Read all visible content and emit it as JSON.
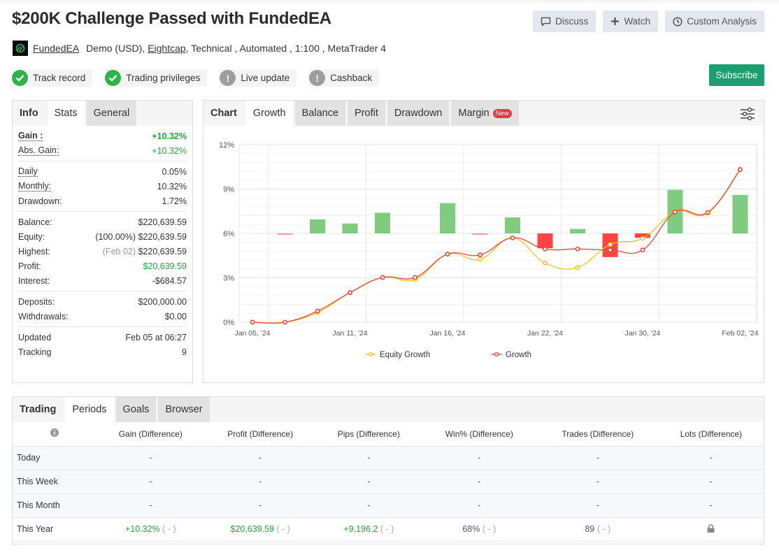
{
  "header": {
    "title": "$200K Challenge Passed with FundedEA",
    "buttons": [
      {
        "label": "Discuss",
        "icon": "comment-icon"
      },
      {
        "label": "Watch",
        "icon": "plus-icon"
      },
      {
        "label": "Custom Analysis",
        "icon": "clock-icon"
      }
    ],
    "author": "FundedEA",
    "meta_prefix": "Demo (USD),",
    "broker": "Eightcap",
    "meta_suffix": ", Technical , Automated , 1:100 , MetaTrader 4",
    "subscribe_label": "Subscribe"
  },
  "badges": [
    {
      "label": "Track record",
      "status": "ok"
    },
    {
      "label": "Trading privileges",
      "status": "ok"
    },
    {
      "label": "Live update",
      "status": "warn"
    },
    {
      "label": "Cashback",
      "status": "warn"
    }
  ],
  "stats_panel": {
    "tabs": [
      {
        "label": "Info"
      },
      {
        "label": "Stats"
      },
      {
        "label": "General"
      }
    ],
    "groups": [
      [
        {
          "label": "Gain :",
          "value": "+10.32%",
          "green": true,
          "bold": true,
          "dotted": true
        },
        {
          "label": "Abs. Gain:",
          "value": "+10.32%",
          "green": true,
          "dotted": true
        }
      ],
      [
        {
          "label": "Daily",
          "value": "0.05%",
          "dotted": true
        },
        {
          "label": "Monthly:",
          "value": "10.32%",
          "dotted": true
        },
        {
          "label": "Drawdown:",
          "value": "1.72%"
        }
      ],
      [
        {
          "label": "Balance:",
          "value": "$220,639.59"
        },
        {
          "label": "Equity:",
          "prefix": "(100.00%)",
          "value": "$220,639.59"
        },
        {
          "label": "Highest:",
          "prefix": "(Feb 02)",
          "prefix_muted": true,
          "value": "$220,639.59"
        },
        {
          "label": "Profit:",
          "value": "$20,639.59",
          "green": true
        },
        {
          "label": "Interest:",
          "value": "-$684.57"
        }
      ],
      [
        {
          "label": "Deposits:",
          "value": "$200,000.00"
        },
        {
          "label": "Withdrawals:",
          "value": "$0.00"
        }
      ],
      [
        {
          "label": "Updated",
          "value": "Feb 05 at 06:27"
        },
        {
          "label": "Tracking",
          "value": "9"
        }
      ]
    ]
  },
  "chart_panel": {
    "tabs": [
      {
        "label": "Chart",
        "type": "head"
      },
      {
        "label": "Growth",
        "type": "active"
      },
      {
        "label": "Balance",
        "type": "inactive"
      },
      {
        "label": "Profit",
        "type": "inactive"
      },
      {
        "label": "Drawdown",
        "type": "inactive"
      },
      {
        "label": "Margin",
        "type": "inactive",
        "badge": "New"
      }
    ]
  },
  "chart_data": {
    "type": "line",
    "title": "",
    "xlabel": "",
    "ylabel": "",
    "ylim": [
      0,
      12
    ],
    "yticks": [
      "0%",
      "3%",
      "6%",
      "9%",
      "12%"
    ],
    "xtick_labels": [
      {
        "label": "Jan 05, '24",
        "index": 0
      },
      {
        "label": "Jan 11, '24",
        "index": 3
      },
      {
        "label": "Jan 16, '24",
        "index": 6
      },
      {
        "label": "Jan 22, '24",
        "index": 9
      },
      {
        "label": "Jan 30, '24",
        "index": 12
      },
      {
        "label": "Feb 02, '24",
        "index": 15
      }
    ],
    "grid": true,
    "legend_position": "bottom",
    "series": [
      {
        "name": "Equity Growth",
        "color": "#f5c518",
        "values": [
          0,
          0,
          0.65,
          2.0,
          3.02,
          2.88,
          4.6,
          4.25,
          5.7,
          4.0,
          3.7,
          5.25,
          5.67,
          7.45,
          7.38,
          10.32
        ]
      },
      {
        "name": "Growth",
        "color": "#e8473c",
        "values": [
          0,
          0,
          0.75,
          2.0,
          3.02,
          3.02,
          4.6,
          4.55,
          5.7,
          4.95,
          4.95,
          4.88,
          4.88,
          7.45,
          7.42,
          10.32
        ]
      }
    ],
    "daily_bars": {
      "baseline": 6,
      "positive_color": "#7fcb7f",
      "negative_color": "#f44",
      "values": [
        null,
        -0.05,
        0.95,
        0.67,
        1.4,
        null,
        2.05,
        -0.05,
        1.08,
        -1.0,
        0.3,
        -1.6,
        -0.3,
        2.95,
        null,
        2.6
      ]
    }
  },
  "periods_panel": {
    "tabs": [
      {
        "label": "Trading",
        "type": "head"
      },
      {
        "label": "Periods",
        "type": "active"
      },
      {
        "label": "Goals",
        "type": "inactive"
      },
      {
        "label": "Browser",
        "type": "inactive"
      }
    ],
    "columns": [
      "",
      "Gain (Difference)",
      "Profit (Difference)",
      "Pips (Difference)",
      "Win% (Difference)",
      "Trades (Difference)",
      "Lots (Difference)"
    ],
    "rows": [
      {
        "period": "Today",
        "cells": [
          "-",
          "-",
          "-",
          "-",
          "-",
          "-"
        ]
      },
      {
        "period": "This Week",
        "cells": [
          "-",
          "-",
          "-",
          "-",
          "-",
          "-"
        ]
      },
      {
        "period": "This Month",
        "cells": [
          "-",
          "-",
          "-",
          "-",
          "-",
          "-"
        ]
      },
      {
        "period": "This Year",
        "cells": [
          "+10.32%",
          "$20,639.59",
          "+9,196.2",
          "68%",
          "89",
          "lock"
        ],
        "green": [
          true,
          true,
          true,
          false,
          false,
          false
        ],
        "diff": "( - )"
      }
    ]
  }
}
